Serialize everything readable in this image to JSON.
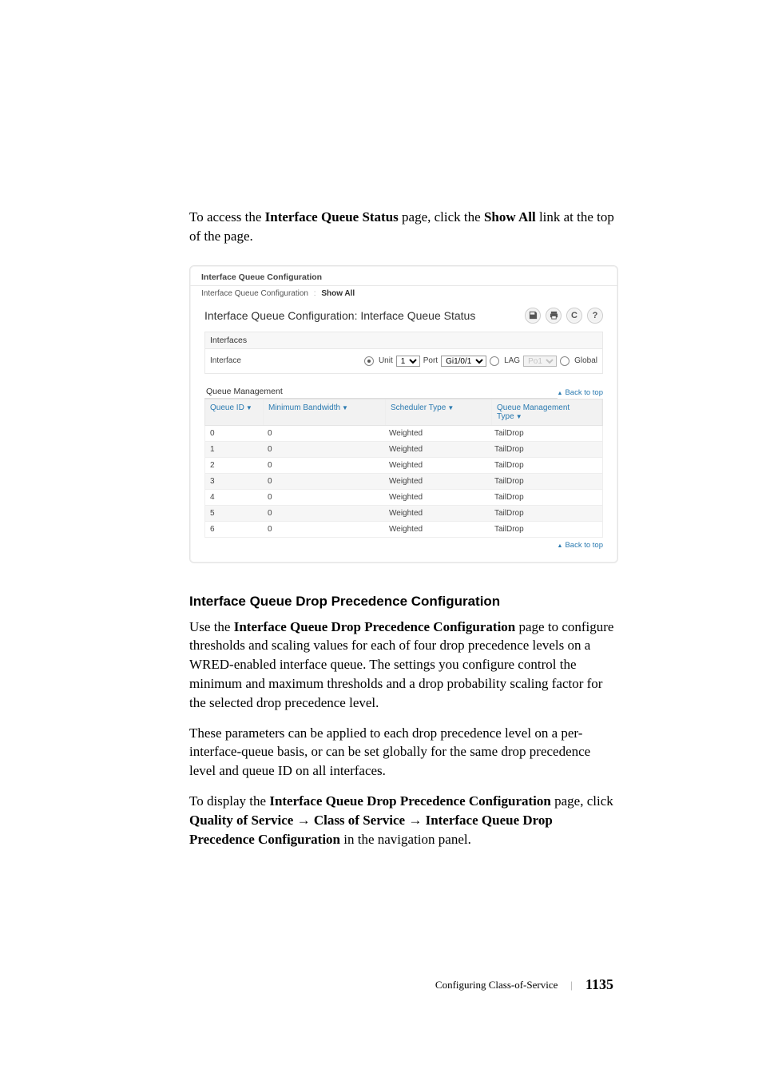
{
  "intro": {
    "pre": "To access the ",
    "b1": "Interface Queue Status",
    "mid": " page, click the ",
    "b2": "Show All",
    "post": " link at the top of the page."
  },
  "panel": {
    "crumb_top": "Interface Queue Configuration",
    "crumb_left": "Interface Queue Configuration",
    "crumb_right": "Show All",
    "title": "Interface Queue Configuration: Interface Queue Status",
    "interfaces_label": "Interfaces",
    "interface_label": "Interface",
    "unit_label": "Unit",
    "unit_val": "1",
    "port_label": "Port",
    "port_val": "Gi1/0/1",
    "lag_label": "LAG",
    "lag_val": "Po1",
    "global_label": "Global",
    "queue_mgmt_label": "Queue Management",
    "back_to_top": "Back to top",
    "cols": {
      "c1": "Queue ID",
      "c2": "Minimum Bandwidth",
      "c3": "Scheduler Type",
      "c4": "Queue Management Type"
    },
    "rows": [
      {
        "id": "0",
        "bw": "0",
        "sched": "Weighted",
        "qm": "TailDrop"
      },
      {
        "id": "1",
        "bw": "0",
        "sched": "Weighted",
        "qm": "TailDrop"
      },
      {
        "id": "2",
        "bw": "0",
        "sched": "Weighted",
        "qm": "TailDrop"
      },
      {
        "id": "3",
        "bw": "0",
        "sched": "Weighted",
        "qm": "TailDrop"
      },
      {
        "id": "4",
        "bw": "0",
        "sched": "Weighted",
        "qm": "TailDrop"
      },
      {
        "id": "5",
        "bw": "0",
        "sched": "Weighted",
        "qm": "TailDrop"
      },
      {
        "id": "6",
        "bw": "0",
        "sched": "Weighted",
        "qm": "TailDrop"
      }
    ]
  },
  "section2": {
    "heading": "Interface Queue Drop Precedence Configuration",
    "p1_pre": "Use the ",
    "p1_b": "Interface Queue Drop Precedence Configuration",
    "p1_post": " page to configure thresholds and scaling values for each of four drop precedence levels on a WRED-enabled interface queue. The settings you configure control the minimum and maximum thresholds and a drop probability scaling factor for the selected drop precedence level.",
    "p2": "These parameters can be applied to each drop precedence level on a per-interface-queue basis, or can be set globally for the same drop precedence level and queue ID on all interfaces.",
    "p3_pre": "To display the ",
    "p3_b1": "Interface Queue Drop Precedence Configuration",
    "p3_mid1": " page, click ",
    "p3_b2": "Quality of Service",
    "p3_arr": " → ",
    "p3_b3": "Class of Service",
    "p3_b4": "Interface Queue Drop Precedence Configuration",
    "p3_post": " in the navigation panel."
  },
  "footer": {
    "chapter": "Configuring Class-of-Service",
    "page": "1135"
  }
}
